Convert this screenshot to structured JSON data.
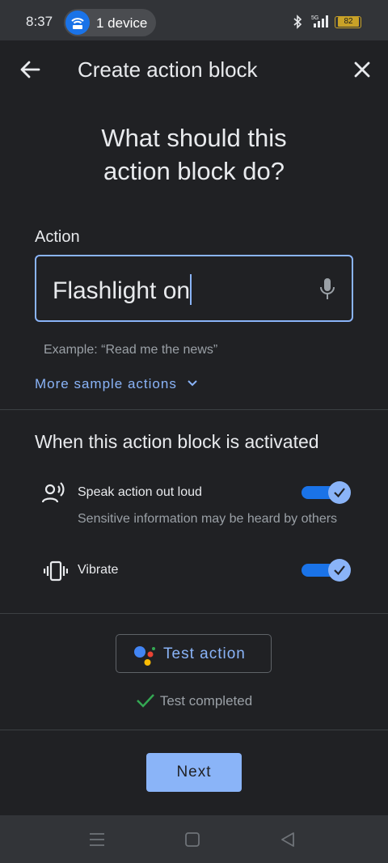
{
  "status_bar": {
    "time": "8:37",
    "device_label": "1 device",
    "battery": "82",
    "network": "5G"
  },
  "app_bar": {
    "title": "Create action block",
    "back_icon": "arrow-back-icon",
    "close_icon": "close-icon"
  },
  "main": {
    "heading_line1": "What should this",
    "heading_line2": "action block do?",
    "action_label": "Action",
    "action_value": "Flashlight on",
    "helper_text": "Example: “Read me the news”",
    "more_samples": "More sample actions"
  },
  "activation": {
    "title": "When this action block is activated",
    "options": [
      {
        "label": "Speak action out loud",
        "sublabel": "Sensitive information may be heard by others",
        "icon": "record-voice-icon",
        "enabled": true
      },
      {
        "label": "Vibrate",
        "icon": "vibration-icon",
        "enabled": true
      }
    ]
  },
  "test": {
    "button_label": "Test action",
    "status": "Test completed"
  },
  "footer": {
    "next_label": "Next"
  },
  "colors": {
    "background": "#202124",
    "accent": "#8ab4f8",
    "toggle_track": "#1a73e8",
    "success": "#34a853"
  }
}
